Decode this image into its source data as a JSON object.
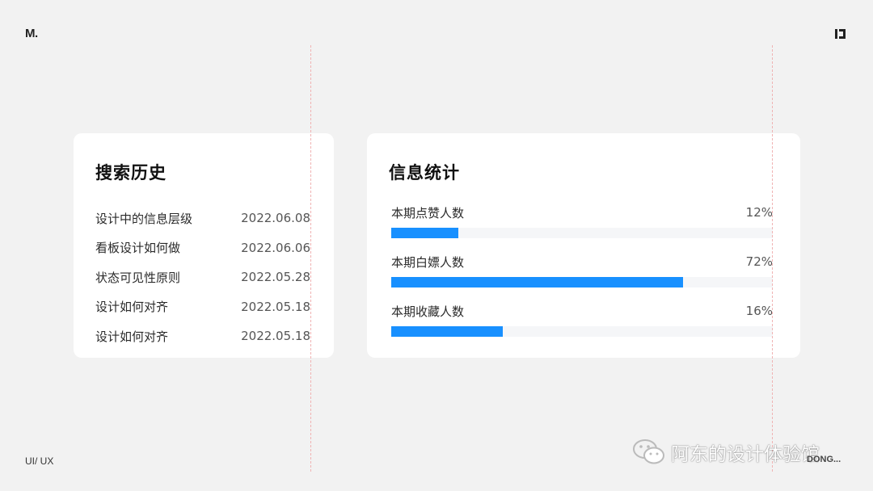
{
  "header": {
    "logo": "M.",
    "corner_icon": "bracket-mark-icon"
  },
  "history_card": {
    "title": "搜索历史",
    "items": [
      {
        "label": "设计中的信息层级",
        "date": "2022.06.08"
      },
      {
        "label": "看板设计如何做",
        "date": "2022.06.06"
      },
      {
        "label": "状态可见性原则",
        "date": "2022.05.28"
      },
      {
        "label": "设计如何对齐",
        "date": "2022.05.18"
      },
      {
        "label": "设计如何对齐",
        "date": "2022.05.18"
      }
    ]
  },
  "stats_card": {
    "title": "信息统计",
    "items": [
      {
        "label": "本期点赞人数",
        "percent_text": "12%"
      },
      {
        "label": "本期白嫖人数",
        "percent_text": "72%"
      },
      {
        "label": "本期收藏人数",
        "percent_text": "16%"
      }
    ],
    "bar_fill_fraction": [
      0.175,
      0.765,
      0.292
    ],
    "bar_color": "#1890ff",
    "track_color": "#f5f6f8"
  },
  "footer": {
    "left": "UI/ UX",
    "watermark": "阿东的设计体验馆",
    "watermark_icon": "wechat-icon",
    "right": "DONG..."
  },
  "colors": {
    "background": "#f2f2f2",
    "card": "#ffffff",
    "guide": "#f0b3b3"
  }
}
